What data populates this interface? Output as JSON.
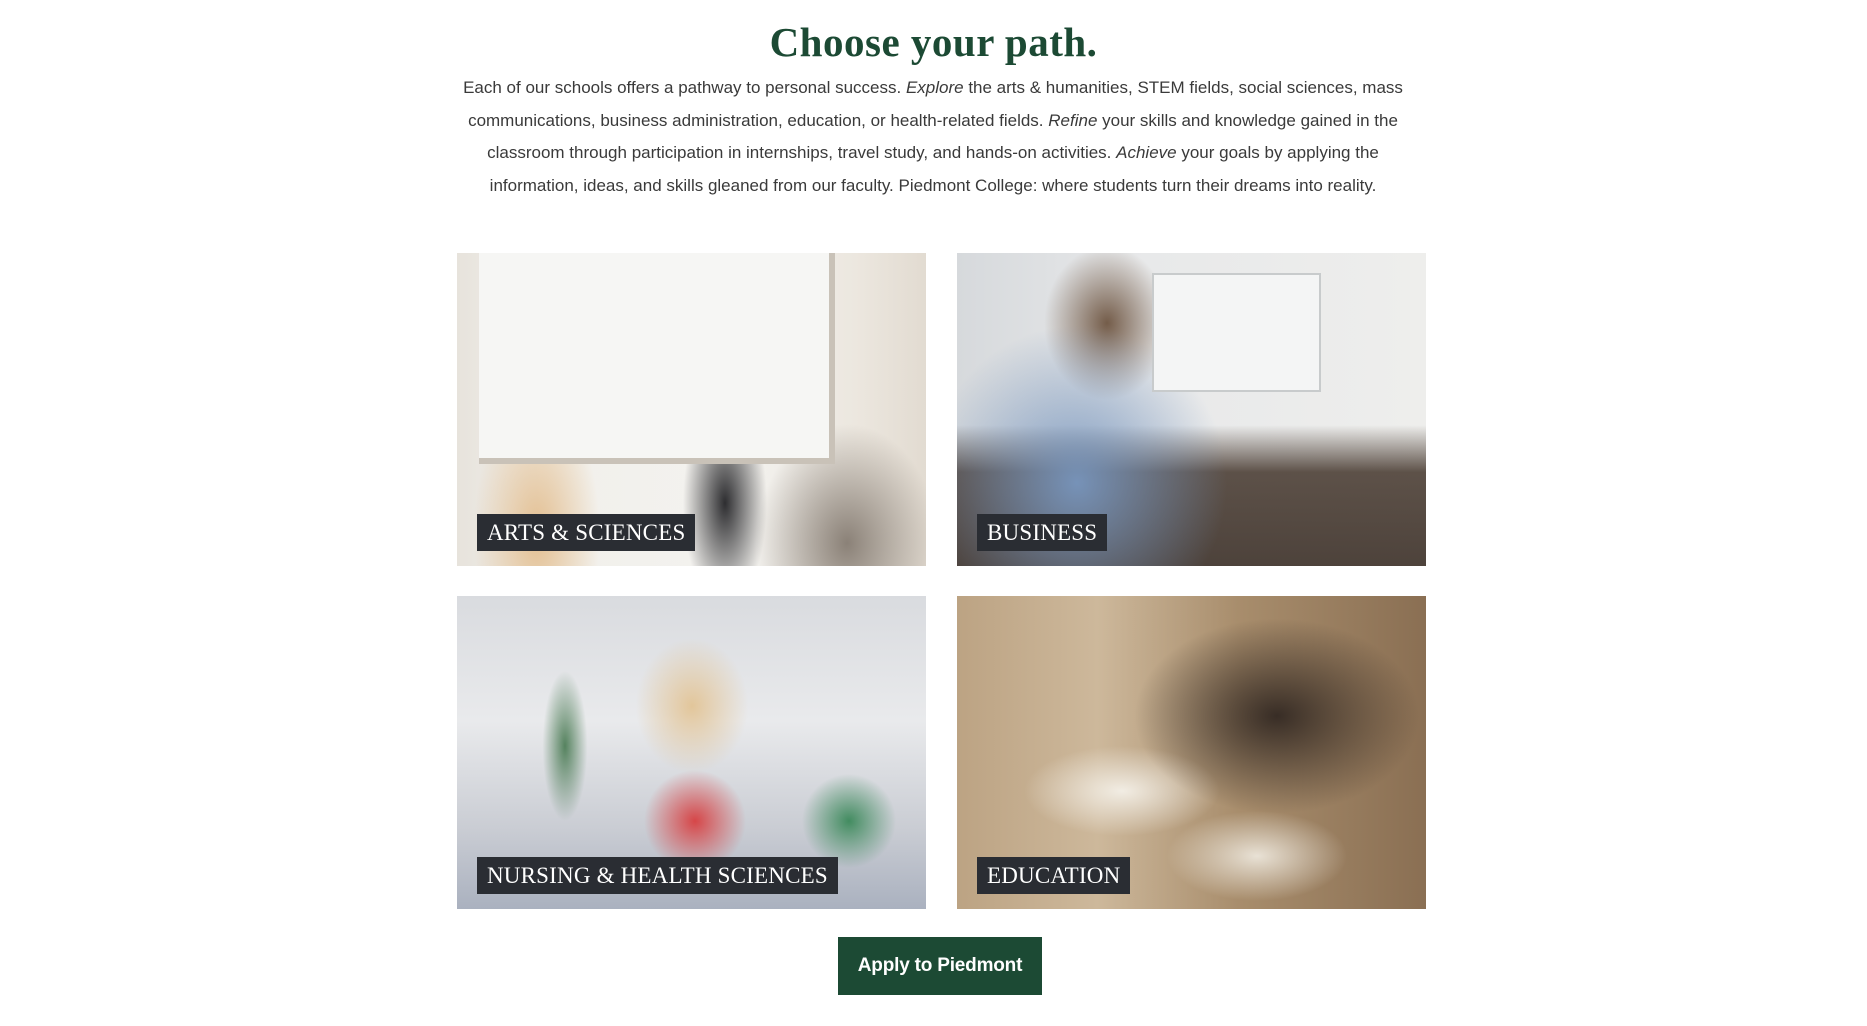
{
  "heading": "Choose your path.",
  "intro": {
    "part1": "Each of our schools offers a pathway to personal success. ",
    "explore": "Explore",
    "part2": " the arts & humanities, STEM fields, social sciences, mass communications, business administration, education, or health-related fields. ",
    "refine": "Refine",
    "part3": " your skills and knowledge gained in the classroom through participation in internships, travel study, and hands-on activities. ",
    "achieve": "Achieve",
    "part4": " your goals by applying the information, ideas, and skills gleaned from our faculty. Piedmont College: where students turn their dreams into reality."
  },
  "schools": [
    {
      "label": "ARTS & SCIENCES"
    },
    {
      "label": "BUSINESS"
    },
    {
      "label": "NURSING & HEALTH SCIENCES"
    },
    {
      "label": "EDUCATION"
    }
  ],
  "cta": {
    "label": "Apply to Piedmont"
  },
  "colors": {
    "brand_green": "#1c4a34",
    "label_bg": "#2a2d33"
  }
}
